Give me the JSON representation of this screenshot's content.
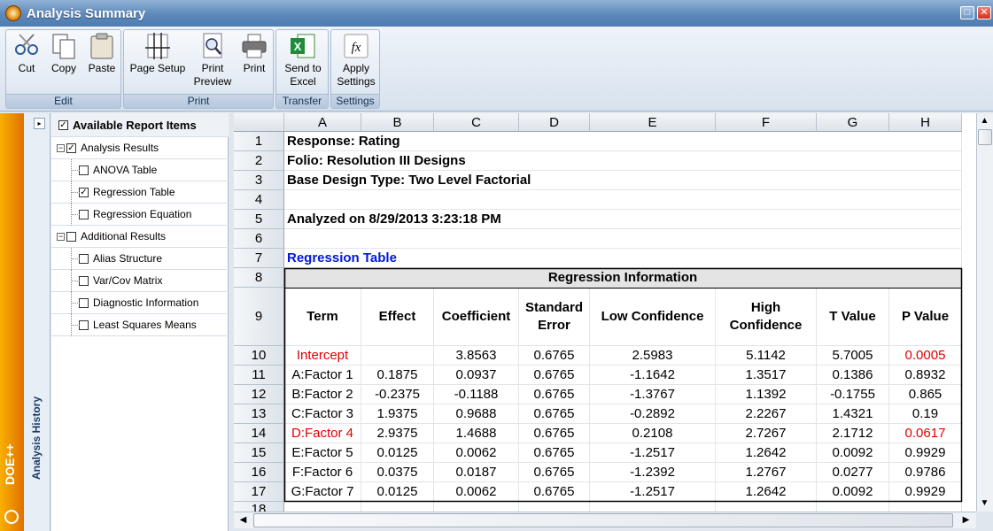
{
  "window": {
    "title": "Analysis Summary",
    "restore_glyph": "□",
    "close_glyph": "✕"
  },
  "ribbon": {
    "groups": [
      {
        "label": "Edit",
        "buttons": [
          {
            "label": "Cut",
            "icon": "scissors-icon"
          },
          {
            "label": "Copy",
            "icon": "copy-icon"
          },
          {
            "label": "Paste",
            "icon": "paste-icon"
          }
        ]
      },
      {
        "label": "Print",
        "buttons": [
          {
            "label": "Page Setup",
            "icon": "page-setup-icon"
          },
          {
            "label": "Print\nPreview",
            "icon": "print-preview-icon"
          },
          {
            "label": "Print",
            "icon": "printer-icon"
          }
        ]
      },
      {
        "label": "Transfer",
        "buttons": [
          {
            "label": "Send to\nExcel",
            "icon": "excel-icon"
          }
        ]
      },
      {
        "label": "Settings",
        "buttons": [
          {
            "label": "Apply\nSettings",
            "icon": "fx-icon"
          }
        ]
      }
    ]
  },
  "sidebar": {
    "brand": "DOE++",
    "history_label": "Analysis History",
    "expand_glyph": "▸"
  },
  "report_items": {
    "header": "Available Report Items",
    "items": [
      {
        "label": "Analysis Results",
        "level": 0,
        "checked": true,
        "toggle": "−"
      },
      {
        "label": "ANOVA Table",
        "level": 1,
        "checked": false
      },
      {
        "label": "Regression Table",
        "level": 1,
        "checked": true
      },
      {
        "label": "Regression Equation",
        "level": 1,
        "checked": false
      },
      {
        "label": "Additional Results",
        "level": 0,
        "checked": false,
        "toggle": "−"
      },
      {
        "label": "Alias Structure",
        "level": 1,
        "checked": false
      },
      {
        "label": "Var/Cov Matrix",
        "level": 1,
        "checked": false
      },
      {
        "label": "Diagnostic Information",
        "level": 1,
        "checked": false
      },
      {
        "label": "Least Squares Means",
        "level": 1,
        "checked": false
      }
    ],
    "check_glyph": "✓"
  },
  "sheet": {
    "columns": [
      "A",
      "B",
      "C",
      "D",
      "E",
      "F",
      "G",
      "H"
    ],
    "rows": [
      "1",
      "2",
      "3",
      "4",
      "5",
      "6",
      "7",
      "8",
      "9",
      "10",
      "11",
      "12",
      "13",
      "14",
      "15",
      "16",
      "17",
      "18"
    ],
    "info_lines": [
      "Response: Rating",
      "Folio: Resolution III Designs",
      "Base Design Type: Two Level Factorial",
      "",
      "Analyzed on 8/29/2013 3:23:18 PM",
      "",
      "Regression Table"
    ],
    "table_title": "Regression Information",
    "table_headers": [
      "Term",
      "Effect",
      "Coefficient",
      "Standard\nError",
      "Low Confidence",
      "High\nConfidence",
      "T Value",
      "P Value"
    ],
    "table_rows": [
      {
        "term": "Intercept",
        "highlight": true,
        "cells": [
          "",
          "3.8563",
          "0.6765",
          "2.5983",
          "5.1142",
          "5.7005",
          "0.0005"
        ]
      },
      {
        "term": "A:Factor 1",
        "highlight": false,
        "cells": [
          "0.1875",
          "0.0937",
          "0.6765",
          "-1.1642",
          "1.3517",
          "0.1386",
          "0.8932"
        ]
      },
      {
        "term": "B:Factor 2",
        "highlight": false,
        "cells": [
          "-0.2375",
          "-0.1188",
          "0.6765",
          "-1.3767",
          "1.1392",
          "-0.1755",
          "0.865"
        ]
      },
      {
        "term": "C:Factor 3",
        "highlight": false,
        "cells": [
          "1.9375",
          "0.9688",
          "0.6765",
          "-0.2892",
          "2.2267",
          "1.4321",
          "0.19"
        ]
      },
      {
        "term": "D:Factor 4",
        "highlight": true,
        "cells": [
          "2.9375",
          "1.4688",
          "0.6765",
          "0.2108",
          "2.7267",
          "2.1712",
          "0.0617"
        ]
      },
      {
        "term": "E:Factor 5",
        "highlight": false,
        "cells": [
          "0.0125",
          "0.0062",
          "0.6765",
          "-1.2517",
          "1.2642",
          "0.0092",
          "0.9929"
        ]
      },
      {
        "term": "F:Factor 6",
        "highlight": false,
        "cells": [
          "0.0375",
          "0.0187",
          "0.6765",
          "-1.2392",
          "1.2767",
          "0.0277",
          "0.9786"
        ]
      },
      {
        "term": "G:Factor 7",
        "highlight": false,
        "cells": [
          "0.0125",
          "0.0062",
          "0.6765",
          "-1.2517",
          "1.2642",
          "0.0092",
          "0.9929"
        ]
      }
    ]
  },
  "scrollbars": {
    "up_glyph": "▲",
    "down_glyph": "▼",
    "left_glyph": "◀",
    "right_glyph": "▶"
  },
  "colors": {
    "highlight_red": "#e00000",
    "link_blue": "#0019d6"
  }
}
